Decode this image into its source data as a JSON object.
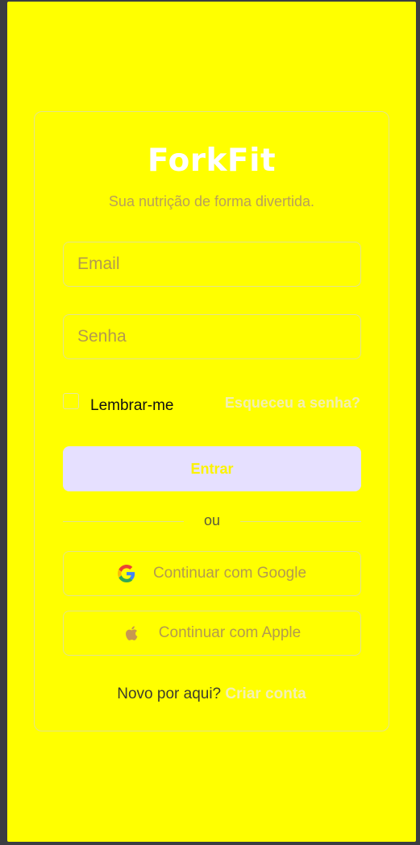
{
  "app": {
    "logo": "ForkFit",
    "tagline": "Sua nutrição de forma divertida."
  },
  "form": {
    "email_placeholder": "Email",
    "password_placeholder": "Senha",
    "remember_label": "Lembrar-me",
    "remember_checked": false,
    "forgot_link": "Esqueceu a senha?",
    "submit_label": "Entrar"
  },
  "divider": {
    "text": "ou"
  },
  "social": {
    "google_label": "Continuar com Google",
    "google_icon": "google-icon",
    "apple_label": "Continuar com Apple",
    "apple_icon": "apple-icon"
  },
  "signup": {
    "prompt": "Novo por aqui?",
    "link": "Criar conta"
  },
  "colors": {
    "background": "#ffff00",
    "card_border": "#e4e48a",
    "primary_button": "#e6e0ff",
    "link": "#f4f0b5"
  }
}
